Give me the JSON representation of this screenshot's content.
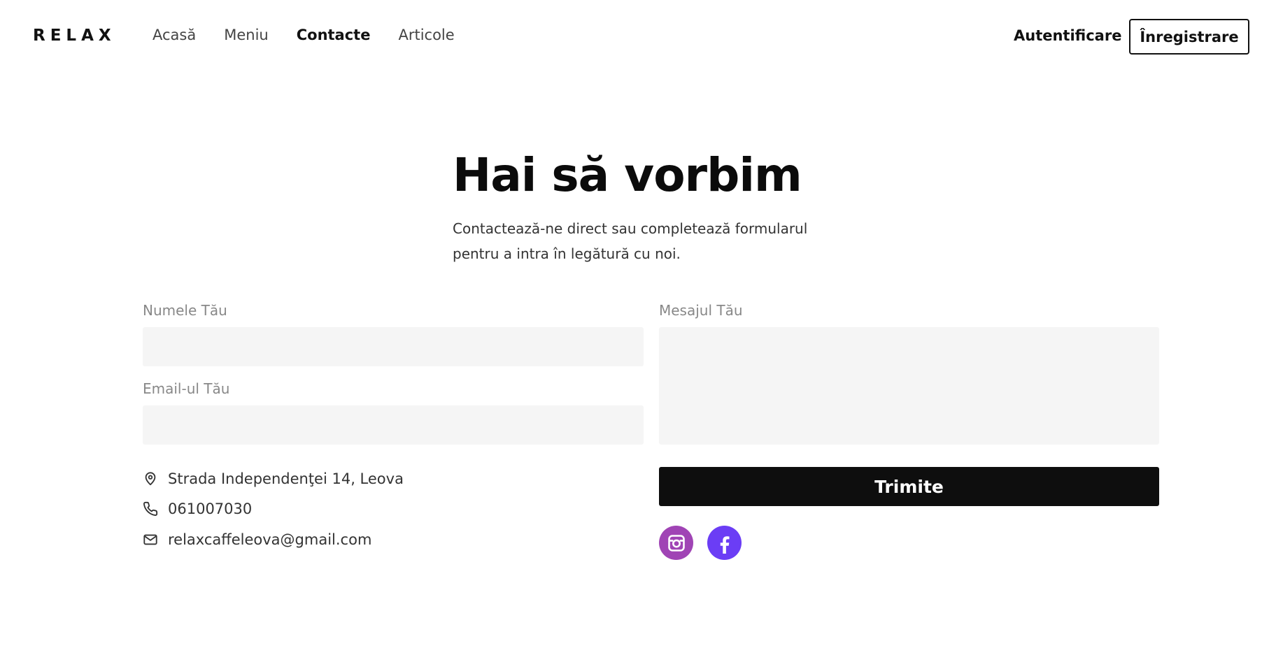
{
  "header": {
    "logo": "RELAX",
    "nav": [
      {
        "label": "Acasă"
      },
      {
        "label": "Meniu"
      },
      {
        "label": "Contacte"
      },
      {
        "label": "Articole"
      }
    ],
    "login_label": "Autentificare",
    "register_label": "Înregistrare"
  },
  "hero": {
    "title": "Hai să vorbim",
    "subtitle": "Contactează-ne direct sau completează formularul pentru a intra în legătură cu noi."
  },
  "form": {
    "name_label": "Numele Tău",
    "name_value": "",
    "email_label": "Email-ul Tău",
    "email_value": "",
    "message_label": "Mesajul Tău",
    "message_value": "",
    "submit_label": "Trimite"
  },
  "contact": {
    "address": "Strada Independenţei 14, Leova",
    "phone": "061007030",
    "email": "relaxcaffeleova@gmail.com"
  },
  "social": [
    {
      "icon": "instagram-icon",
      "color": "#a044b5"
    },
    {
      "icon": "facebook-icon",
      "color": "#6b3df5"
    }
  ],
  "colors": {
    "accent": "#0e0e0e",
    "field_bg": "#f5f5f5"
  }
}
